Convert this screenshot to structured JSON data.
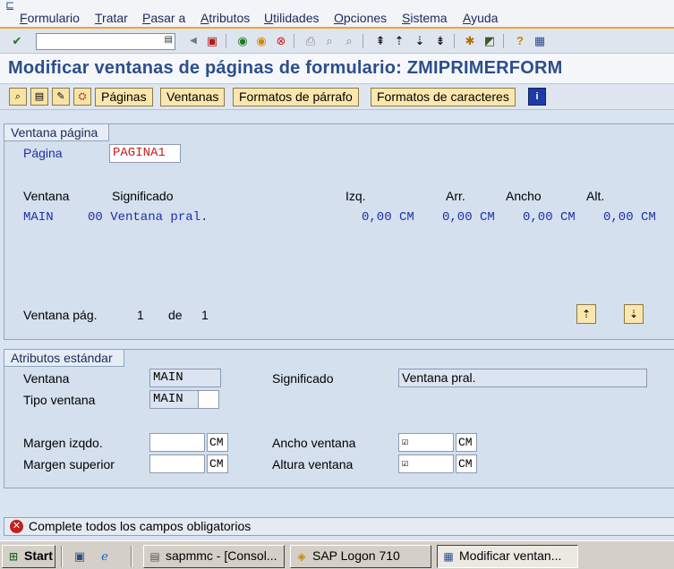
{
  "menu": [
    "Formulario",
    "Tratar",
    "Pasar a",
    "Atributos",
    "Utilidades",
    "Opciones",
    "Sistema",
    "Ayuda"
  ],
  "title": "Modificar ventanas de páginas de formulario: ZMIPRIMERFORM",
  "app_toolbar": {
    "buttons": [
      "Páginas",
      "Ventanas",
      "Formatos de párrafo",
      "Formatos de caracteres"
    ]
  },
  "window_page": {
    "group_title": "Ventana página",
    "page_label": "Página",
    "page_value": "PAGINA1",
    "headers": {
      "window": "Ventana",
      "meaning": "Significado",
      "left": "Izq.",
      "top": "Arr.",
      "width": "Ancho",
      "height": "Alt."
    },
    "row": {
      "window": "MAIN",
      "meaning": "00 Ventana pral.",
      "left": "0,00 CM",
      "top": "0,00 CM",
      "width": "0,00 CM",
      "height": "0,00 CM"
    },
    "pager": {
      "label": "Ventana pág.",
      "current": "1",
      "of": "de",
      "total": "1"
    }
  },
  "std_attributes": {
    "group_title": "Atributos estándar",
    "window_label": "Ventana",
    "window_value": "MAIN",
    "meaning_label": "Significado",
    "meaning_value": "Ventana pral.",
    "type_label": "Tipo ventana",
    "type_value": "MAIN",
    "left_margin_label": "Margen izqdo.",
    "left_margin_unit": "CM",
    "top_margin_label": "Margen superior",
    "top_margin_unit": "CM",
    "width_label": "Ancho ventana",
    "width_unit": "CM",
    "height_label": "Altura ventana",
    "height_unit": "CM",
    "check_mark": "☑"
  },
  "status": {
    "message": "Complete todos los campos obligatorios"
  },
  "taskbar": {
    "start": "Start",
    "tasks": [
      "sapmmc - [Consol...",
      "SAP Logon 710",
      "Modificar ventan..."
    ]
  },
  "icons": {
    "system": "system-menu-icon",
    "accent": "#f3a331",
    "title_color": "#2c4e8c",
    "error": "#c41f1f"
  }
}
